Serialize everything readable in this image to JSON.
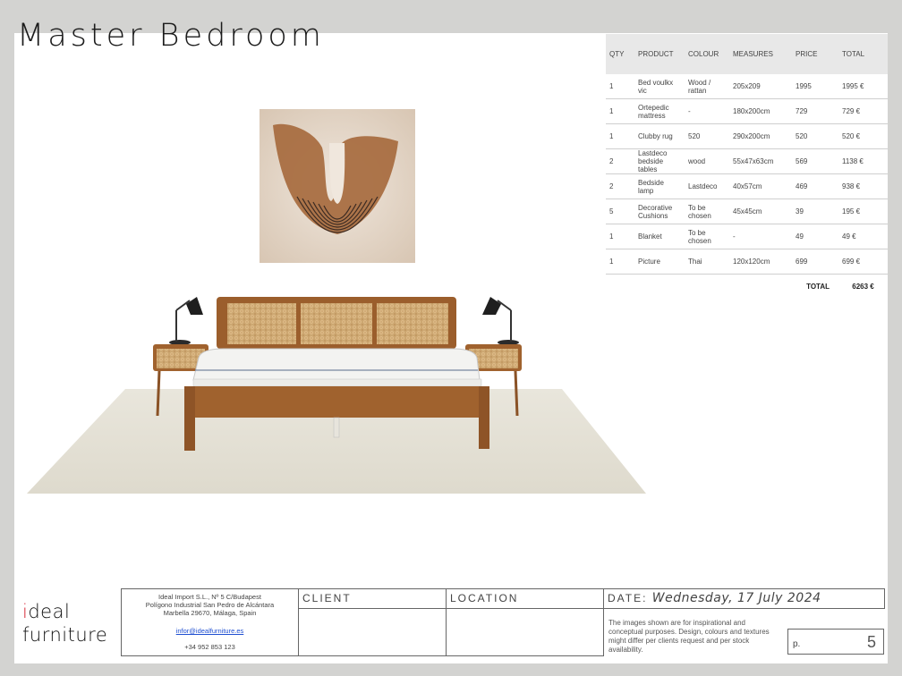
{
  "page": {
    "title": "Master Bedroom"
  },
  "table": {
    "headers": [
      "QTY",
      "PRODUCT",
      "COLOUR",
      "MEASURES",
      "PRICE",
      "TOTAL"
    ],
    "rows": [
      [
        "1",
        "Bed voulkx vic",
        "Wood / rattan",
        "205x209",
        "1995",
        "1995 €"
      ],
      [
        "1",
        "Ortepedic mattress",
        "-",
        "180x200cm",
        "729",
        "729 €"
      ],
      [
        "1",
        "Clubby rug",
        "520",
        "290x200cm",
        "520",
        "520 €"
      ],
      [
        "2",
        "Lastdeco bedside tables",
        "wood",
        "55x47x63cm",
        "569",
        "1138 €"
      ],
      [
        "2",
        "Bedside lamp",
        "Lastdeco",
        "40x57cm",
        "469",
        "938 €"
      ],
      [
        "5",
        "Decorative Cushions",
        "To be chosen",
        "45x45cm",
        "39",
        "195 €"
      ],
      [
        "1",
        "Blanket",
        "To be chosen",
        "-",
        "49",
        "49 €"
      ],
      [
        "1",
        "Picture",
        "Thai",
        "120x120cm",
        "699",
        "699 €"
      ]
    ],
    "total_label": "TOTAL",
    "total_value": "6263 €"
  },
  "footer": {
    "logo_line1_i": "i",
    "logo_line1_rest": "deal",
    "logo_line2": "furniture",
    "company_line1": "Ideal Import S.L., Nº 5 C/Budapest",
    "company_line2": "Polígono Industrial San Pedro de Alcántara",
    "company_line3": "Marbella 29670, Málaga, Spain",
    "email": "infor@idealfurniture.es",
    "phone": "+34 952 853 123",
    "client_label": "CLIENT",
    "location_label": "LOCATION",
    "date_label": "DATE:",
    "date_value": "Wednesday, 17 July 2024",
    "disclaimer": "The images shown are for inspirational and conceptual purposes. Design, colours and textures might differ per clients request and per stock availability.",
    "page_label": "p.",
    "page_number": "5"
  },
  "colors": {
    "accent_red": "#d6202f",
    "link_blue": "#1f4fd1",
    "wood": "#a0622e",
    "rattan": "#d9b67e"
  }
}
